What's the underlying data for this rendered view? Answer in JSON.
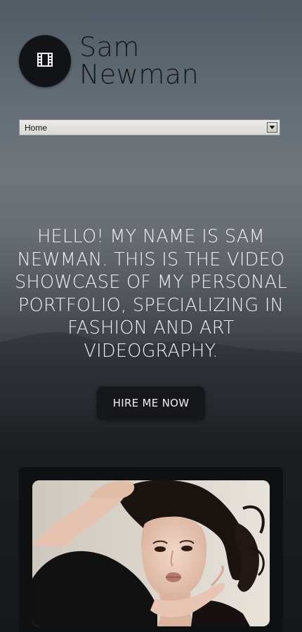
{
  "site": {
    "name_line1": "Sam",
    "name_line2": "Newman",
    "logo_icon": "film-icon"
  },
  "nav": {
    "selected": "Home"
  },
  "hero": {
    "text": "HELLO! MY NAME IS SAM NEWMAN. THIS IS THE VIDEO SHOWCASE OF MY PERSONAL PORTFOLIO, SPECIALIZING IN FASHION AND ART VIDEOGRAPHY.",
    "cta_label": "HIRE ME NOW"
  },
  "media": {
    "thumbnail": "portrait-photo"
  },
  "colors": {
    "logo_bg": "#121316",
    "button_bg": "#15171a",
    "card_bg": "#0f1012",
    "hero_text": "#eeeff1"
  }
}
